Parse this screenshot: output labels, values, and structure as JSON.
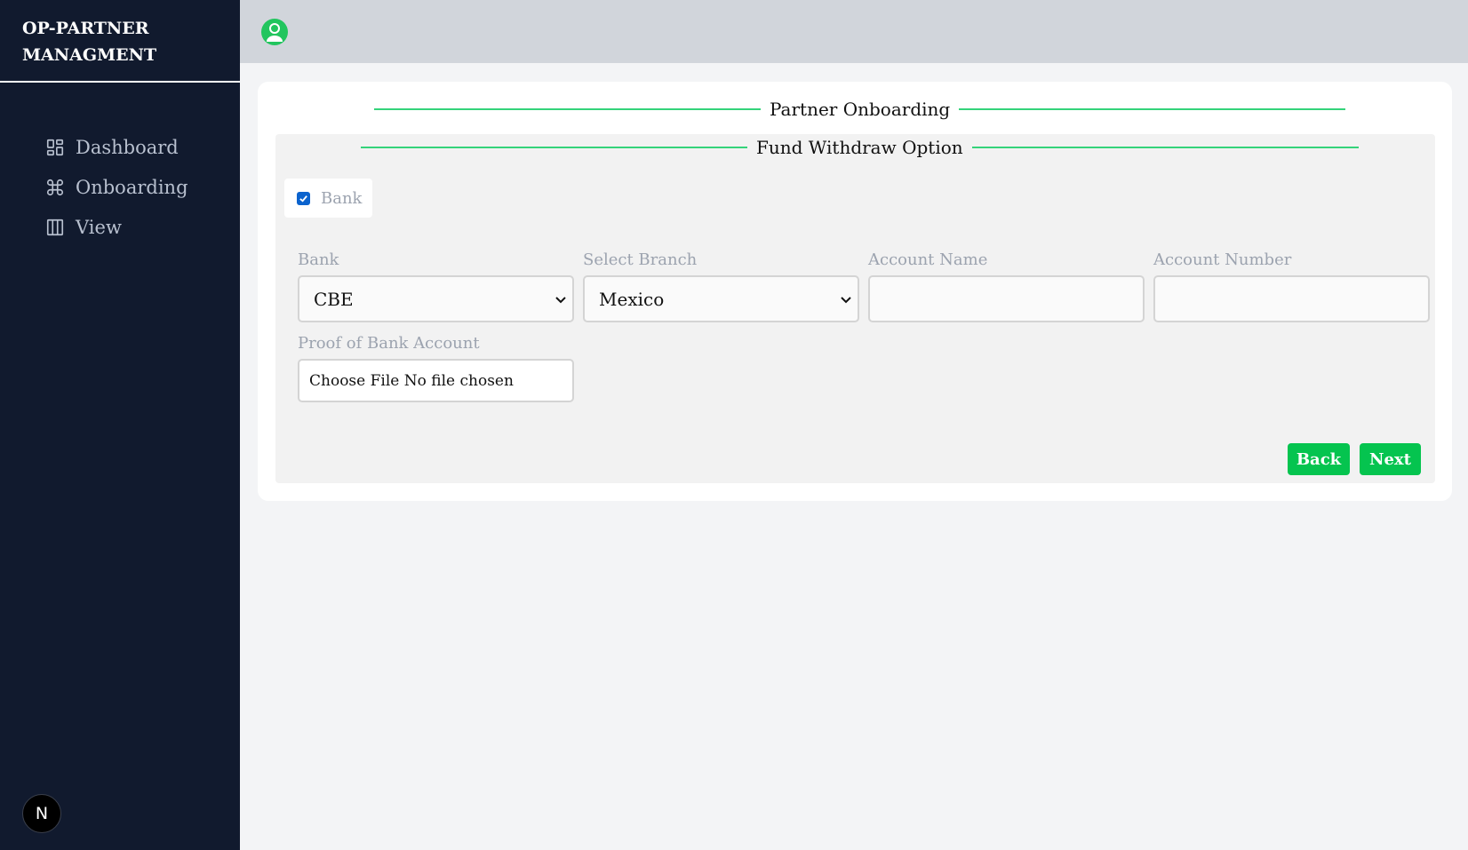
{
  "sidebar": {
    "brand_line1": "OP-PARTNER",
    "brand_line2": "MANAGMENT",
    "items": [
      {
        "label": "Dashboard",
        "icon": "dashboard-icon"
      },
      {
        "label": "Onboarding",
        "icon": "command-icon"
      },
      {
        "label": "View",
        "icon": "columns-icon"
      }
    ],
    "badge_letter": "N"
  },
  "header": {
    "avatar_icon": "user-avatar-icon",
    "accent_color": "#22c55e"
  },
  "main": {
    "title": "Partner Onboarding",
    "section_title": "Fund Withdraw Option",
    "bank_checkbox": {
      "label": "Bank",
      "checked": true
    },
    "fields": {
      "bank": {
        "label": "Bank",
        "value": "CBE"
      },
      "branch": {
        "label": "Select Branch",
        "value": "Mexico"
      },
      "account_name": {
        "label": "Account Name",
        "value": ""
      },
      "account_number": {
        "label": "Account Number",
        "value": ""
      },
      "proof": {
        "label": "Proof of Bank Account",
        "value": "Choose File No file chosen"
      }
    },
    "buttons": {
      "back": "Back",
      "next": "Next"
    }
  }
}
